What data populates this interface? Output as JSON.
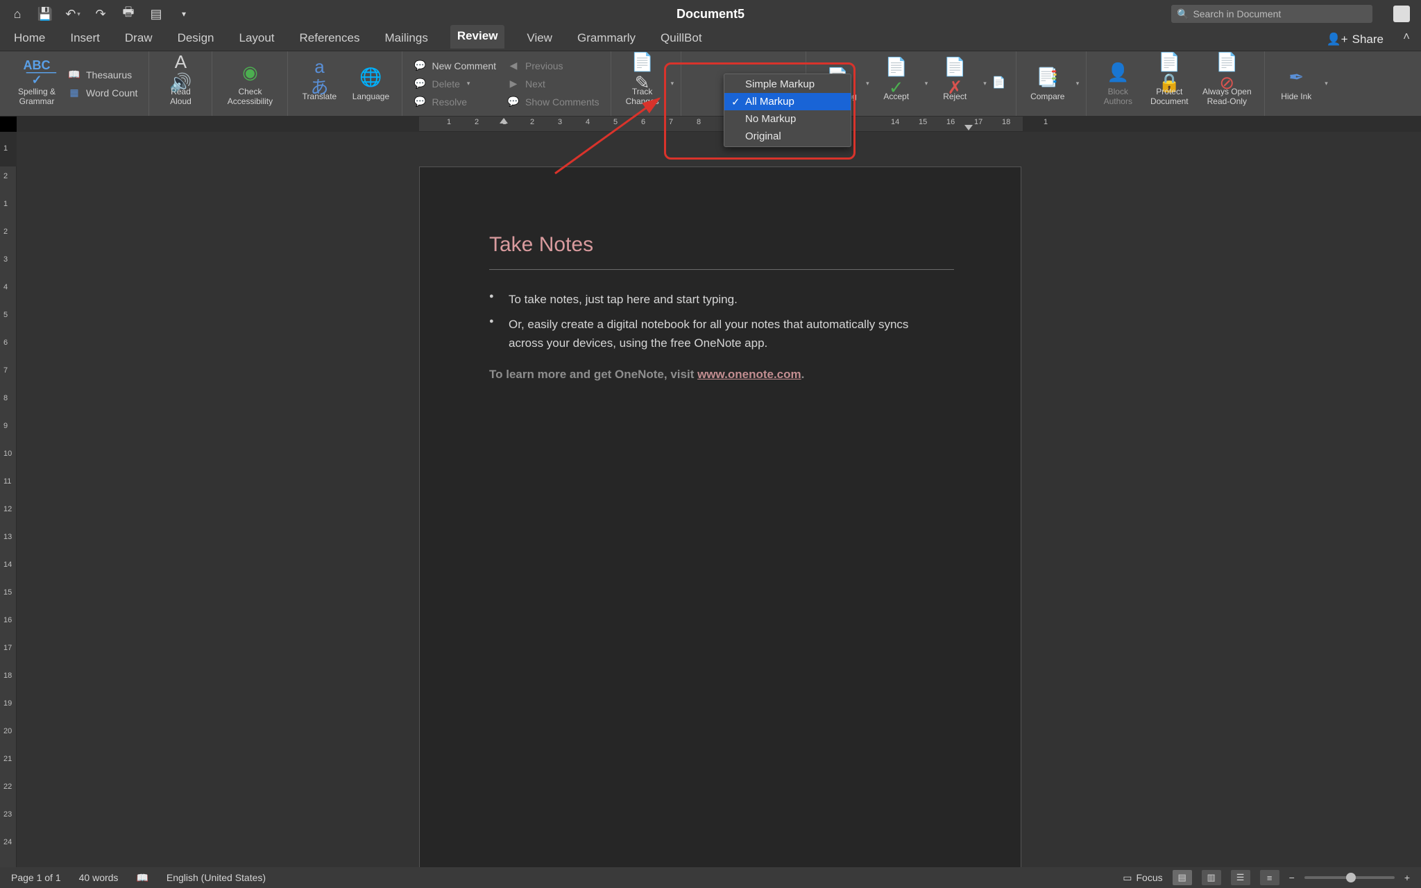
{
  "title": "Document5",
  "search_placeholder": "Search in Document",
  "tabs": [
    "Home",
    "Insert",
    "Draw",
    "Design",
    "Layout",
    "References",
    "Mailings",
    "Review",
    "View",
    "Grammarly",
    "QuillBot"
  ],
  "active_tab": "Review",
  "share_label": "Share",
  "ribbon": {
    "spelling": "Spelling &\nGrammar",
    "thesaurus": "Thesaurus",
    "wordcount": "Word Count",
    "readaloud": "Read\nAloud",
    "accessibility": "Check\nAccessibility",
    "translate": "Translate",
    "language": "Language",
    "newcomment": "New Comment",
    "delete": "Delete",
    "resolve": "Resolve",
    "previous": "Previous",
    "next": "Next",
    "showcomments": "Show Comments",
    "trackchanges": "Track\nChanges",
    "reviewing": "Reviewing",
    "accept": "Accept",
    "reject": "Reject",
    "compare": "Compare",
    "blockauthors": "Block\nAuthors",
    "protect": "Protect\nDocument",
    "alwaysro": "Always Open\nRead-Only",
    "hideink": "Hide Ink"
  },
  "markup_menu": [
    "Simple Markup",
    "All Markup",
    "No Markup",
    "Original"
  ],
  "markup_selected": "All Markup",
  "hruler": [
    "1",
    "2",
    "1",
    "2",
    "3",
    "4",
    "5",
    "6",
    "7",
    "8",
    "14",
    "15",
    "16",
    "17",
    "18",
    "1"
  ],
  "vruler": [
    "1",
    "2",
    "1",
    "2",
    "3",
    "4",
    "5",
    "6",
    "7",
    "8",
    "9",
    "10",
    "11",
    "12",
    "13",
    "14",
    "15",
    "16",
    "17",
    "18",
    "19",
    "20",
    "21",
    "22",
    "23",
    "24"
  ],
  "doc": {
    "heading": "Take Notes",
    "bullets": [
      "To take notes, just tap here and start typing.",
      "Or, easily create a digital notebook for all your notes that automatically syncs across your devices, using the free OneNote app."
    ],
    "more_prefix": "To learn more and get OneNote, visit ",
    "more_link": "www.onenote.com",
    "more_suffix": "."
  },
  "status": {
    "page": "Page 1 of 1",
    "words": "40 words",
    "lang": "English (United States)",
    "focus": "Focus"
  }
}
